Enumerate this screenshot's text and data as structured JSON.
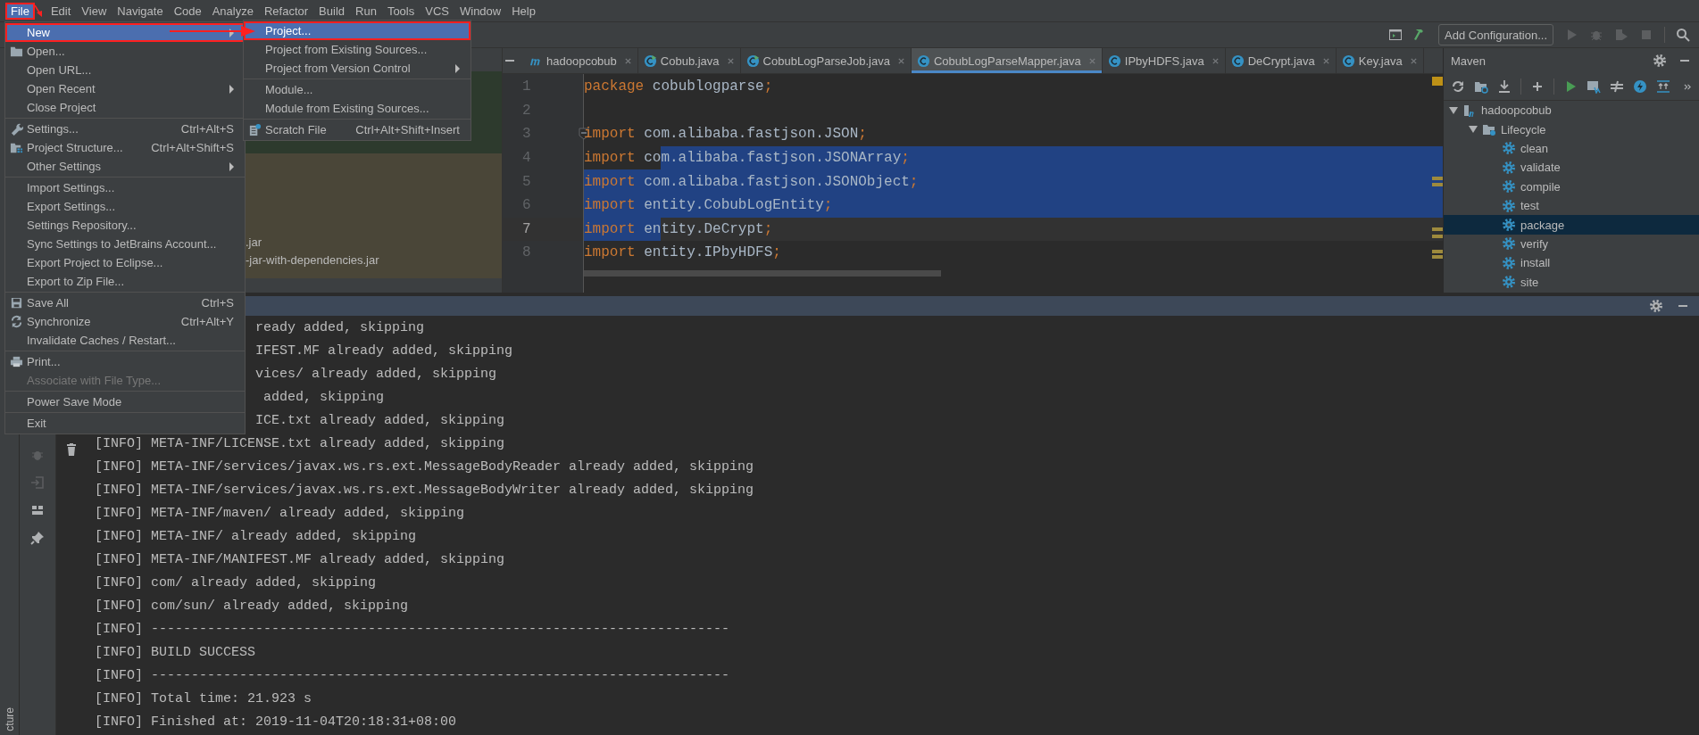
{
  "menu_bar": [
    {
      "label": "File",
      "selected": true,
      "marked": true
    },
    {
      "label": "Edit",
      "selected": false,
      "marked": false
    },
    {
      "label": "View",
      "selected": false,
      "marked": false
    },
    {
      "label": "Navigate",
      "selected": false,
      "marked": false
    },
    {
      "label": "Code",
      "selected": false,
      "marked": false
    },
    {
      "label": "Analyze",
      "selected": false,
      "marked": false
    },
    {
      "label": "Refactor",
      "selected": false,
      "marked": false
    },
    {
      "label": "Build",
      "selected": false,
      "marked": false
    },
    {
      "label": "Run",
      "selected": false,
      "marked": false
    },
    {
      "label": "Tools",
      "selected": false,
      "marked": false
    },
    {
      "label": "VCS",
      "selected": false,
      "marked": false
    },
    {
      "label": "Window",
      "selected": false,
      "marked": false
    },
    {
      "label": "Help",
      "selected": false,
      "marked": false
    }
  ],
  "toolbar": {
    "run_configuration": "Add Configuration..."
  },
  "file_menu": [
    {
      "kind": "item",
      "label": "New",
      "selected": true,
      "marked": true,
      "submenu": true,
      "disabled": false
    },
    {
      "kind": "item",
      "label": "Open...",
      "selected": false,
      "marked": false,
      "submenu": false,
      "disabled": false
    },
    {
      "kind": "item",
      "label": "Open URL...",
      "selected": false,
      "marked": false,
      "submenu": false,
      "disabled": false
    },
    {
      "kind": "item",
      "label": "Open Recent",
      "selected": false,
      "marked": false,
      "submenu": true,
      "disabled": false
    },
    {
      "kind": "item",
      "label": "Close Project",
      "selected": false,
      "marked": false,
      "submenu": false,
      "disabled": false
    },
    {
      "kind": "separator"
    },
    {
      "kind": "item",
      "label": "Settings...",
      "shortcut": "Ctrl+Alt+S",
      "selected": false,
      "marked": false,
      "submenu": false,
      "disabled": false
    },
    {
      "kind": "item",
      "label": "Project Structure...",
      "shortcut": "Ctrl+Alt+Shift+S",
      "selected": false,
      "marked": false,
      "submenu": false,
      "disabled": false
    },
    {
      "kind": "item",
      "label": "Other Settings",
      "selected": false,
      "marked": false,
      "submenu": true,
      "disabled": false
    },
    {
      "kind": "separator"
    },
    {
      "kind": "item",
      "label": "Import Settings...",
      "selected": false,
      "marked": false,
      "submenu": false,
      "disabled": false
    },
    {
      "kind": "item",
      "label": "Export Settings...",
      "selected": false,
      "marked": false,
      "submenu": false,
      "disabled": false
    },
    {
      "kind": "item",
      "label": "Settings Repository...",
      "selected": false,
      "marked": false,
      "submenu": false,
      "disabled": false
    },
    {
      "kind": "item",
      "label": "Sync Settings to JetBrains Account...",
      "selected": false,
      "marked": false,
      "submenu": false,
      "disabled": false
    },
    {
      "kind": "item",
      "label": "Export Project to Eclipse...",
      "selected": false,
      "marked": false,
      "submenu": false,
      "disabled": false
    },
    {
      "kind": "item",
      "label": "Export to Zip File...",
      "selected": false,
      "marked": false,
      "submenu": false,
      "disabled": false
    },
    {
      "kind": "separator"
    },
    {
      "kind": "item",
      "label": "Save All",
      "shortcut": "Ctrl+S",
      "selected": false,
      "marked": false,
      "submenu": false,
      "disabled": false
    },
    {
      "kind": "item",
      "label": "Synchronize",
      "shortcut": "Ctrl+Alt+Y",
      "selected": false,
      "marked": false,
      "submenu": false,
      "disabled": false
    },
    {
      "kind": "item",
      "label": "Invalidate Caches / Restart...",
      "selected": false,
      "marked": false,
      "submenu": false,
      "disabled": false
    },
    {
      "kind": "separator"
    },
    {
      "kind": "item",
      "label": "Print...",
      "selected": false,
      "marked": false,
      "submenu": false,
      "disabled": false
    },
    {
      "kind": "item",
      "label": "Associate with File Type...",
      "selected": false,
      "marked": false,
      "submenu": false,
      "disabled": true
    },
    {
      "kind": "separator"
    },
    {
      "kind": "item",
      "label": "Power Save Mode",
      "selected": false,
      "marked": false,
      "submenu": false,
      "disabled": false
    },
    {
      "kind": "separator"
    },
    {
      "kind": "item",
      "label": "Exit",
      "selected": false,
      "marked": false,
      "submenu": false,
      "disabled": false
    }
  ],
  "new_submenu": [
    {
      "kind": "item",
      "label": "Project...",
      "selected": true,
      "marked": true,
      "submenu": false,
      "disabled": false
    },
    {
      "kind": "item",
      "label": "Project from Existing Sources...",
      "selected": false,
      "marked": false,
      "submenu": false,
      "disabled": false
    },
    {
      "kind": "item",
      "label": "Project from Version Control",
      "selected": false,
      "marked": false,
      "submenu": true,
      "disabled": false
    },
    {
      "kind": "separator"
    },
    {
      "kind": "item",
      "label": "Module...",
      "selected": false,
      "marked": false,
      "submenu": false,
      "disabled": false
    },
    {
      "kind": "item",
      "label": "Module from Existing Sources...",
      "selected": false,
      "marked": false,
      "submenu": false,
      "disabled": false
    },
    {
      "kind": "separator"
    },
    {
      "kind": "item",
      "label": "Scratch File",
      "shortcut": "Ctrl+Alt+Shift+Insert",
      "selected": false,
      "marked": false,
      "submenu": false,
      "disabled": false
    }
  ],
  "project_panel": {
    "files": [
      ".jar",
      "-jar-with-dependencies.jar"
    ]
  },
  "editor": {
    "tabs": [
      {
        "label": "hadoopcobub",
        "kind": "maven",
        "selected": false
      },
      {
        "label": "Cobub.java",
        "kind": "main-class",
        "selected": false
      },
      {
        "label": "CobubLogParseJob.java",
        "kind": "main-class",
        "selected": false
      },
      {
        "label": "CobubLogParseMapper.java",
        "kind": "class",
        "selected": true
      },
      {
        "label": "IPbyHDFS.java",
        "kind": "class",
        "selected": false
      },
      {
        "label": "DeCrypt.java",
        "kind": "class",
        "selected": false
      },
      {
        "label": "Key.java",
        "kind": "class",
        "selected": false
      }
    ],
    "lines": [
      {
        "number": "1",
        "keyword": "package",
        "rest": "cobublogparse",
        "end": ";",
        "kind": "plain",
        "current": false
      },
      {
        "number": "2",
        "kind": "plain",
        "current": false
      },
      {
        "number": "3",
        "keyword": "import",
        "rest": "com.alibaba.fastjson.JSON",
        "end": ";",
        "kind": "plain",
        "current": false
      },
      {
        "number": "4",
        "keyword": "import",
        "rest": "com.alibaba.fastjson.JSONArray",
        "end": ";",
        "kind": "tail",
        "current": false
      },
      {
        "number": "5",
        "keyword": "import",
        "rest": "com.alibaba.fastjson.JSONObject",
        "end": ";",
        "kind": "selected",
        "current": false
      },
      {
        "number": "6",
        "keyword": "import",
        "rest": "entity.CobubLogEntity",
        "end": ";",
        "kind": "selected",
        "current": false
      },
      {
        "number": "7",
        "keyword": "import",
        "rest": "entity.DeCrypt",
        "end": ";",
        "kind": "head",
        "current": true
      },
      {
        "number": "8",
        "keyword": "import",
        "rest": "entity.IPbyHDFS",
        "end": ";",
        "kind": "plain",
        "current": false
      }
    ]
  },
  "maven": {
    "title": "Maven",
    "tree": [
      {
        "label": "hadoopcobub",
        "kind": "project",
        "expanded": true,
        "selected": false,
        "children": [
          {
            "label": "Lifecycle",
            "kind": "folder",
            "expanded": true,
            "selected": false,
            "children": [
              {
                "label": "clean",
                "kind": "goal",
                "selected": false
              },
              {
                "label": "validate",
                "kind": "goal",
                "selected": false
              },
              {
                "label": "compile",
                "kind": "goal",
                "selected": false
              },
              {
                "label": "test",
                "kind": "goal",
                "selected": false
              },
              {
                "label": "package",
                "kind": "goal",
                "selected": true
              },
              {
                "label": "verify",
                "kind": "goal",
                "selected": false
              },
              {
                "label": "install",
                "kind": "goal",
                "selected": false
              },
              {
                "label": "site",
                "kind": "goal",
                "selected": false
              }
            ]
          }
        ]
      }
    ]
  },
  "console": {
    "lines": [
      {
        "text": "ready added, skipping",
        "kind": "partial"
      },
      {
        "text": "IFEST.MF already added, skipping",
        "kind": "partial"
      },
      {
        "text": "vices/ already added, skipping",
        "kind": "partial"
      },
      {
        "text": " added, skipping",
        "kind": "partial"
      },
      {
        "text": "ICE.txt already added, skipping",
        "kind": "partial"
      },
      {
        "text": "[INFO] META-INF/LICENSE.txt already added, skipping",
        "kind": "full"
      },
      {
        "text": "[INFO] META-INF/services/javax.ws.rs.ext.MessageBodyReader already added, skipping",
        "kind": "full"
      },
      {
        "text": "[INFO] META-INF/services/javax.ws.rs.ext.MessageBodyWriter already added, skipping",
        "kind": "full"
      },
      {
        "text": "[INFO] META-INF/maven/ already added, skipping",
        "kind": "full"
      },
      {
        "text": "[INFO] META-INF/ already added, skipping",
        "kind": "full"
      },
      {
        "text": "[INFO] META-INF/MANIFEST.MF already added, skipping",
        "kind": "full"
      },
      {
        "text": "[INFO] com/ already added, skipping",
        "kind": "full"
      },
      {
        "text": "[INFO] com/sun/ already added, skipping",
        "kind": "full"
      },
      {
        "text": "[INFO] ------------------------------------------------------------------------",
        "kind": "full"
      },
      {
        "text": "[INFO] BUILD SUCCESS",
        "kind": "full"
      },
      {
        "text": "[INFO] ------------------------------------------------------------------------",
        "kind": "full"
      },
      {
        "text": "[INFO] Total time: 21.923 s",
        "kind": "full"
      },
      {
        "text": "[INFO] Finished at: 2019-11-04T20:18:31+08:00",
        "kind": "full"
      }
    ]
  },
  "side_strip": {
    "label": "cture"
  }
}
